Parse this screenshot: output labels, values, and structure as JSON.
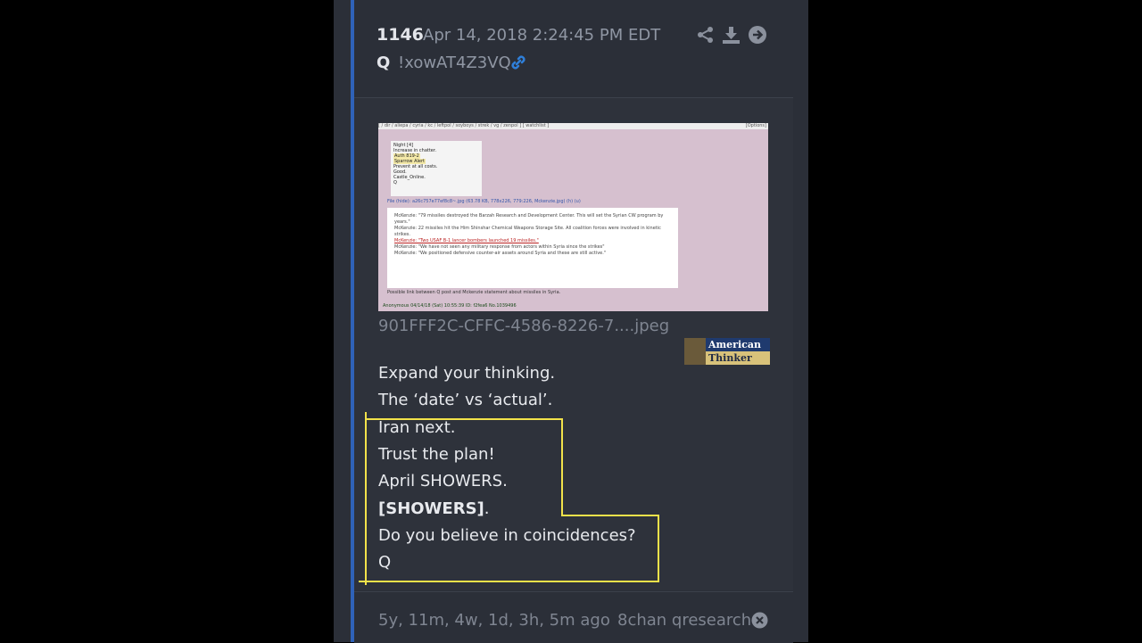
{
  "post": {
    "number": "1146",
    "date": "Apr 14, 2018 2:24:45 PM EDT",
    "author": "Q",
    "tripcode": "!xowAT4Z3VQ",
    "icons": [
      "share-icon",
      "download-icon",
      "arrow-right-circle-icon",
      "link-icon",
      "close-circle-icon"
    ]
  },
  "image": {
    "filename": "901FFF2C-CFFC-4586-8226-7....jpeg",
    "thumb": {
      "toolbar": "[ / dir / aliepa / cyria / kc / leftpol / soyboys / strek / vg / zenpol ] [ watchlist ]",
      "options": "[Options]",
      "card_lines": [
        "Night [4]",
        "Increase in chatter.",
        "Auth 819-2",
        "Sparrow Alert",
        "Prevent at all costs.",
        "Good.",
        "Castle_Online.",
        "Q"
      ],
      "file_line": "File (hide): a26c757e77ef8c8~.jpg (63.78 KB, 778x226, 779:226, Mckenzie.jpg) (h) (u)",
      "bullets": [
        "McKenzie: \"79 missiles destroyed the Barzah Research and Development Center. This will set the Syrian CW program by years.\"",
        "McKenzie: 22 missiles hit the Him Shinshar Chemical Weapons Storage Site. All coalition forces were involved in kinetic strikes.",
        "McKenzie: \"Two USAF B-1 lancer bombers launched 19 missiles.\"",
        "McKenzie: \"We have not seen any military response from actors within Syria since the strikes\"",
        "McKenzie: \"We positioned defensive counter-air assets around Syria and these are still active.\""
      ],
      "caption": "Possible link between Q post and Mckenzie statement about missiles in Syria.",
      "anon": "Anonymous 04/14/18 (Sat) 10:55:39 ID: f2fea6 No.1039496"
    },
    "logo_top": "American",
    "logo_bottom": "Thinker"
  },
  "message": {
    "lines": [
      "Expand your thinking.",
      "The ‘date’ vs ‘actual’.",
      "Iran next.",
      "Trust the plan!",
      "April SHOWERS.",
      "[SHOWERS]",
      ".",
      "Do you believe in coincidences?",
      "Q"
    ]
  },
  "footer": {
    "ago": "5y, 11m, 4w, 1d, 3h, 5m ago",
    "source": "8chan qresearch"
  },
  "colors": {
    "accent": "#2f62b8",
    "highlight": "#f2e24a"
  }
}
